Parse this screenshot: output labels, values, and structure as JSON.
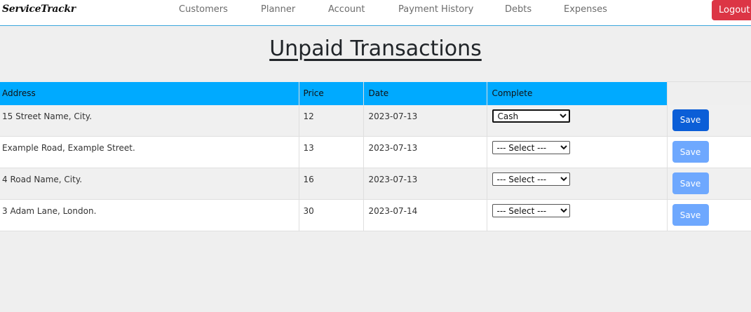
{
  "brand": "ServiceTrackr",
  "nav": {
    "customers": "Customers",
    "planner": "Planner",
    "account": "Account",
    "payment_history": "Payment History",
    "debts": "Debts",
    "expenses": "Expenses",
    "logout": "Logout"
  },
  "page_title": "Unpaid Transactions",
  "table": {
    "headers": [
      "Address",
      "Price",
      "Date",
      "Complete",
      ""
    ],
    "rows": [
      {
        "address": "15 Street Name, City.",
        "price": "12",
        "date": "2023-07-13",
        "complete": "Cash",
        "save": "Save"
      },
      {
        "address": "Example Road, Example Street.",
        "price": "13",
        "date": "2023-07-13",
        "complete": "--- Select ---",
        "save": "Save"
      },
      {
        "address": "4 Road Name, City.",
        "price": "16",
        "date": "2023-07-13",
        "complete": "--- Select ---",
        "save": "Save"
      },
      {
        "address": "3 Adam Lane, London.",
        "price": "30",
        "date": "2023-07-14",
        "complete": "--- Select ---",
        "save": "Save"
      }
    ]
  },
  "colors": {
    "header_bg": "#00aaff",
    "logout_bg": "#dc3545",
    "save_active": "#0b5ed7",
    "save_disabled": "#6ea8fe",
    "nav_border": "#3aa6dd"
  }
}
